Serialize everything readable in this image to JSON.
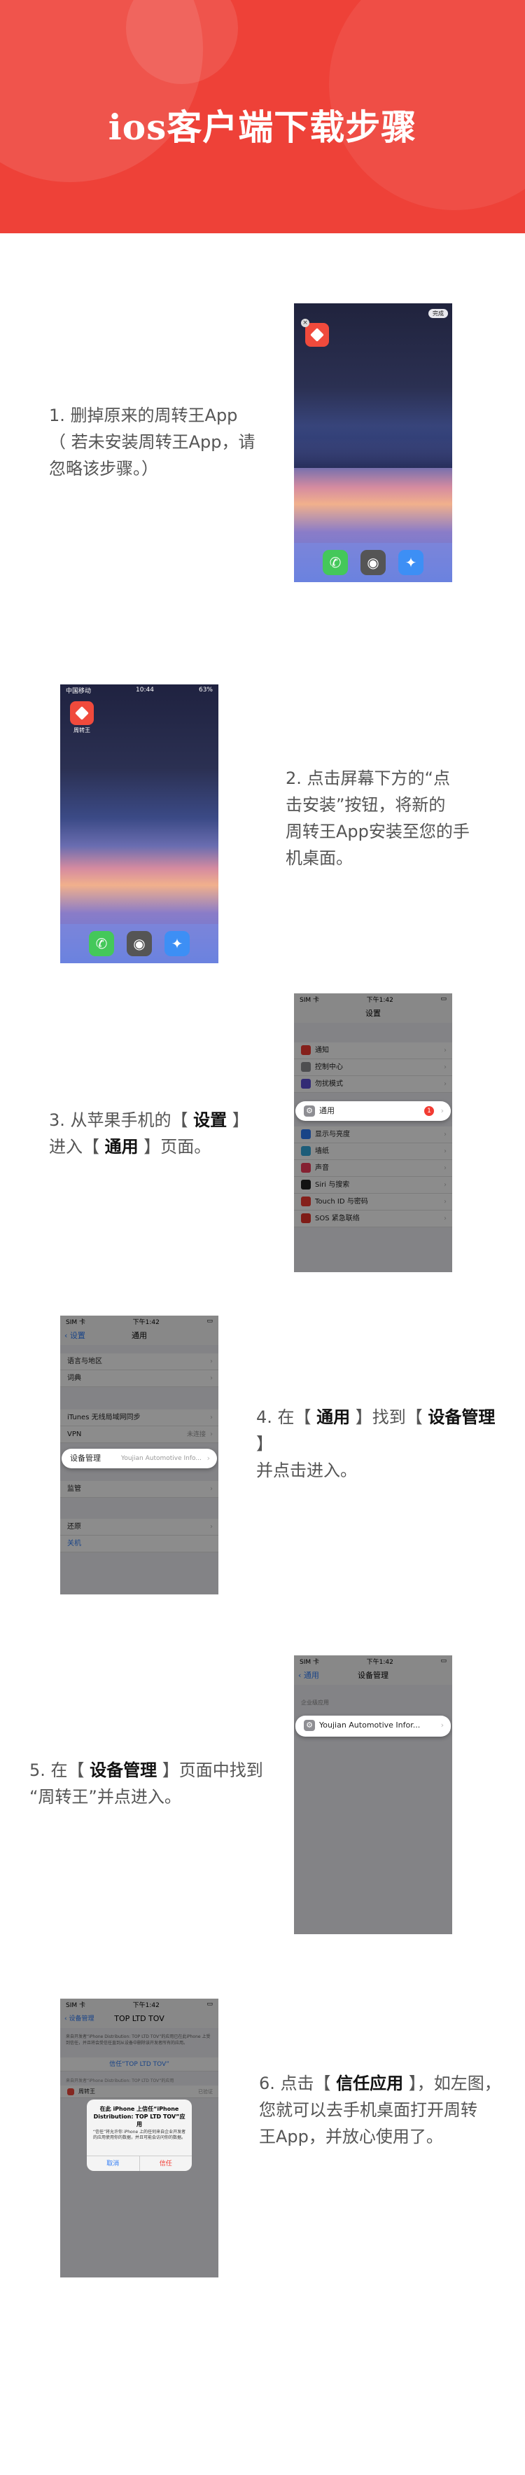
{
  "header": {
    "title": "ios客户端下载步骤"
  },
  "steps": [
    {
      "lines": [
        "1. 删掉原来的周转王App",
        "（ 若未安装周转王App，请",
        "忽略该步骤。）"
      ]
    },
    {
      "lines": [
        "2. 点击屏幕下方的“点",
        "击安装”按钮，将新的",
        "周转王App安装至您的手",
        "机桌面。"
      ]
    },
    {
      "pre": "3. 从苹果手机的【 ",
      "k1": "设置",
      "mid": " 】",
      "line2pre": "进入【 ",
      "k2": "通用",
      "line2post": " 】页面。"
    },
    {
      "pre": "4. 在【 ",
      "k1": "通用",
      "mid": " 】找到【 ",
      "k2": "设备管理",
      "post": " 】",
      "line2": "并点击进入。"
    },
    {
      "pre": "5. 在【 ",
      "k1": "设备管理",
      "mid": " 】页面中找到",
      "line2": "“周转王”并点进入。"
    },
    {
      "pre": "6. 点击【 ",
      "k1": "信任应用",
      "mid": " 】，如左图，",
      "line2": "您就可以去手机桌面打开周转",
      "line3": "王App，并放心使用了。"
    }
  ],
  "screens": {
    "home1": {
      "done": "完成"
    },
    "home2": {
      "time": "10:44",
      "carrier": "中国移动",
      "battery": "63%",
      "app_label": "周转王"
    },
    "settings": {
      "carrier": "SIM 卡",
      "time": "下午1:42",
      "title": "设置",
      "items": [
        "通知",
        "控制中心",
        "勿扰模式",
        "通用",
        "显示与亮度",
        "墙纸",
        "声音",
        "Siri 与搜索",
        "Touch ID 与密码",
        "SOS 紧急联络"
      ],
      "badge": "1"
    },
    "general": {
      "carrier": "SIM 卡",
      "time": "下午1:42",
      "back": "设置",
      "title": "通用",
      "items": [
        "语言与地区",
        "词典",
        "iTunes 无线局域网同步",
        "VPN",
        "设备管理",
        "监管",
        "还原",
        "关机"
      ],
      "vpn_value": "未连接",
      "device_value": "Youjian Automotive Info..."
    },
    "devmgmt": {
      "carrier": "SIM 卡",
      "time": "下午1:42",
      "back": "通用",
      "title": "设备管理",
      "section": "企业级应用",
      "item": "Youjian Automotive Infor..."
    },
    "trust": {
      "carrier": "SIM 卡",
      "time": "下午1:42",
      "back": "设备管理",
      "title": "TOP LTD TOV",
      "desc": "来自开发者“iPhone Distribution: TOP LTD TOV”的应用已在此iPhone 上受到信任，并且将会受信任直到从设备中删除该开发者所有的应用。",
      "trust_link": "信任“TOP LTD TOV”",
      "section2": "来自开发者“iPhone Distribution: TOP LTD TOV”的应用",
      "app_name": "周转王",
      "alert_title": "在此 iPhone 上信任“iPhone Distribution: TOP LTD TOV”应用",
      "alert_body": "“信任”将允许你 iPhone 上的任何来自企业开发者的应用使用你的数据，并且可能会访问你的数据。",
      "cancel": "取消",
      "ok": "信任",
      "verify": "已验证"
    }
  },
  "colors": {
    "brand": "#ee4138",
    "ios_blue": "#2f7cf6"
  }
}
